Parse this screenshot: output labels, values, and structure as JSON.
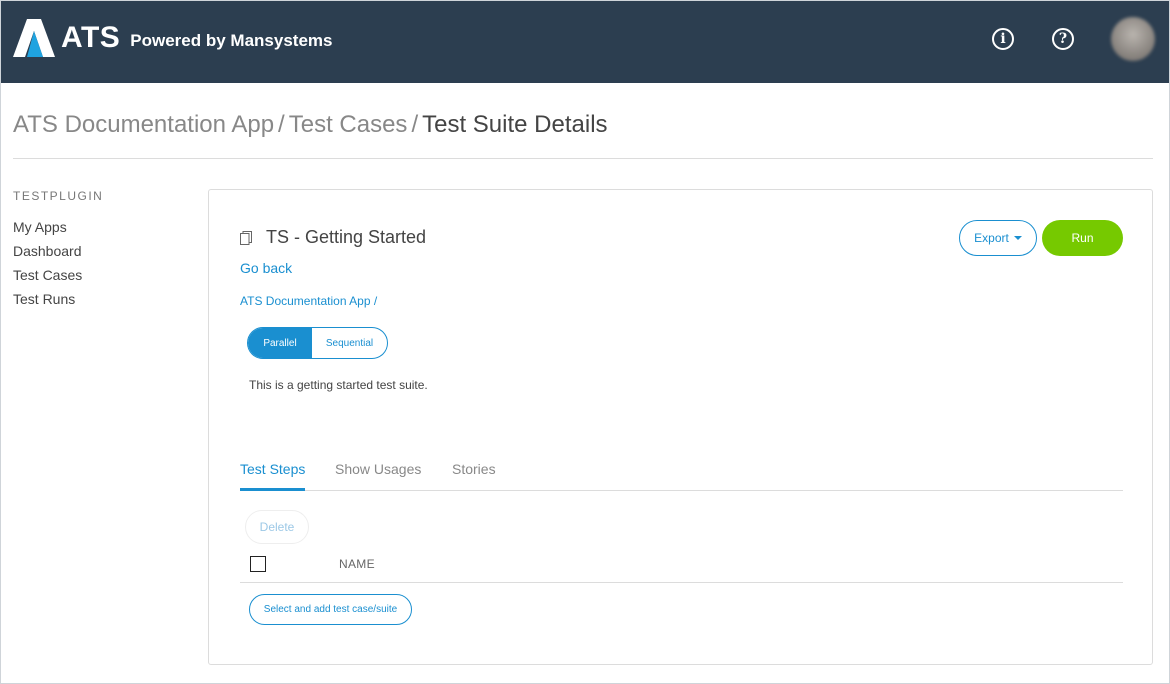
{
  "header": {
    "logo_text": "ATS",
    "logo_subtitle": "Powered by Mansystems",
    "info_icon": "info-icon",
    "help_icon": "help-icon",
    "avatar": "user-avatar"
  },
  "breadcrumb": {
    "items": [
      "ATS Documentation App",
      "Test Cases"
    ],
    "separator": "/",
    "current": "Test Suite Details"
  },
  "sidebar": {
    "heading": "TESTPLUGIN",
    "items": [
      {
        "label": "My Apps"
      },
      {
        "label": "Dashboard"
      },
      {
        "label": "Test Cases"
      },
      {
        "label": "Test Runs"
      }
    ]
  },
  "suite": {
    "title": "TS - Getting Started",
    "go_back": "Go back",
    "path": "ATS Documentation App /",
    "description": "This is a getting started test suite."
  },
  "actions": {
    "export_label": "Export",
    "run_label": "Run"
  },
  "mode": {
    "options": [
      "Parallel",
      "Sequential"
    ],
    "selected": "Parallel"
  },
  "tabs": [
    {
      "label": "Test Steps",
      "active": true
    },
    {
      "label": "Show Usages",
      "active": false
    },
    {
      "label": "Stories",
      "active": false
    }
  ],
  "table": {
    "delete_label": "Delete",
    "columns": [
      "NAME"
    ],
    "add_label": "Select and add test case/suite"
  },
  "colors": {
    "topbar": "#2c3e50",
    "accent": "#1a8fd0",
    "run": "#76c900"
  }
}
